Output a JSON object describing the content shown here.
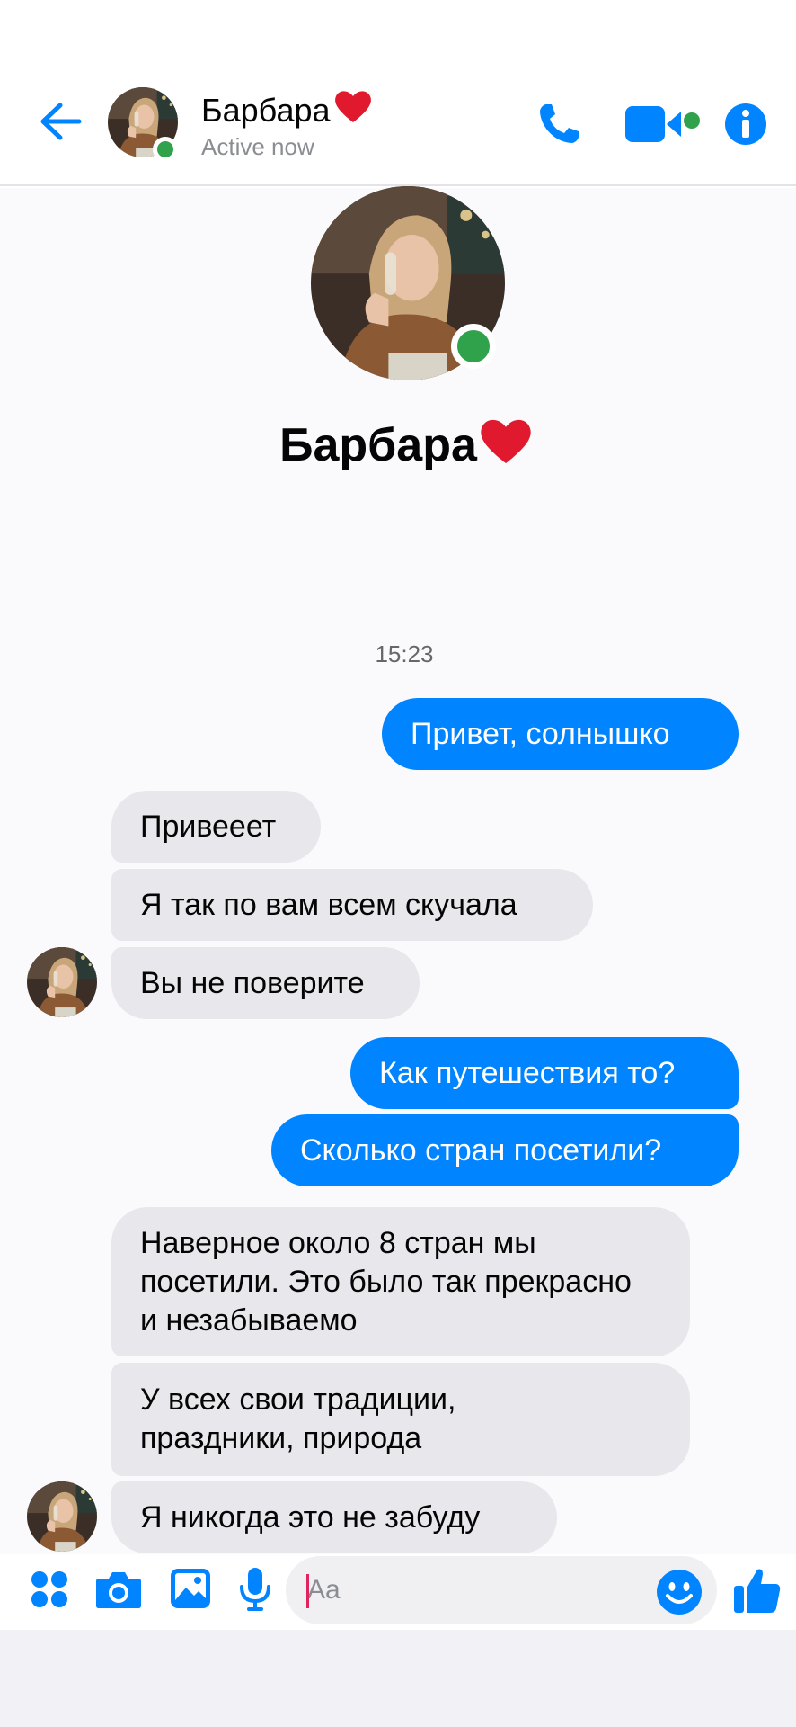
{
  "header": {
    "name": "Барбара",
    "name_emoji": "❤️",
    "status": "Active now"
  },
  "profile": {
    "name": "Барбара",
    "name_emoji": "❤️"
  },
  "timestamp": "15:23",
  "messages": [
    {
      "dir": "out",
      "text": "Привет, солнышко"
    },
    {
      "dir": "in",
      "text": "Привееет"
    },
    {
      "dir": "in",
      "text": "Я так по вам всем скучала"
    },
    {
      "dir": "in",
      "text": "Вы не поверите"
    },
    {
      "dir": "out",
      "text": "Как путешествия то?"
    },
    {
      "dir": "out",
      "text": "Сколько стран посетили?"
    },
    {
      "dir": "in",
      "text": "Наверное около 8 стран мы посетили.  Это было так прекрасно и незабываемо"
    },
    {
      "dir": "in",
      "text": "У всех свои традиции, праздники, природа"
    },
    {
      "dir": "in",
      "text": "Я никогда это не забуду"
    }
  ],
  "composer": {
    "placeholder": "Aa"
  },
  "colors": {
    "accent": "#0084ff",
    "online": "#31a24c",
    "incoming_bubble": "#e8e7ec"
  },
  "icons": [
    "back-arrow-icon",
    "phone-icon",
    "video-camera-icon",
    "info-icon",
    "apps-icon",
    "camera-icon",
    "image-icon",
    "microphone-icon",
    "emoji-icon",
    "thumbs-up-icon"
  ]
}
